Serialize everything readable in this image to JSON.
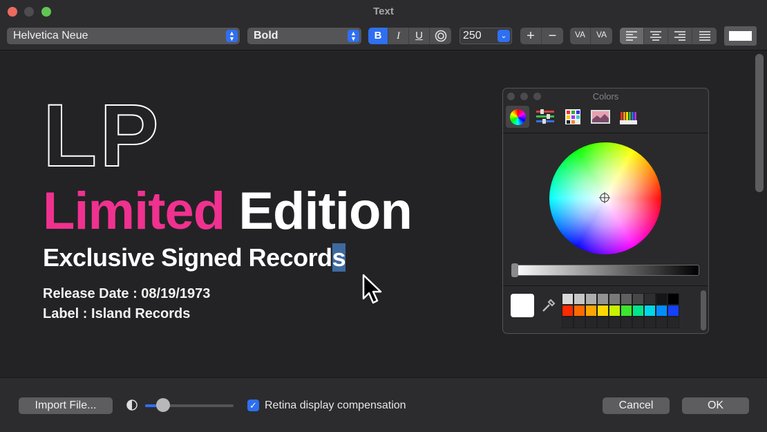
{
  "window": {
    "title": "Text"
  },
  "toolbar": {
    "font_family": "Helvetica Neue",
    "font_style": "Bold",
    "bold_label": "B",
    "italic_label": "I",
    "underline_label": "U",
    "font_size": "250",
    "increase_label": "+",
    "decrease_label": "−",
    "kern_tighten_label": "VA",
    "kern_loosen_label": "VA",
    "text_color": "#ffffff"
  },
  "canvas": {
    "line1": "LP",
    "line2_pink": "Limited",
    "line2_white": "Edition",
    "line3_main": "Exclusive Signed Record",
    "line3_selected": "s",
    "line4": "Release Date : 08/19/1973",
    "line5": "Label : Island Records",
    "pink_color": "#f0318f"
  },
  "colors_panel": {
    "title": "Colors",
    "modes": [
      "color-wheel",
      "color-sliders",
      "color-palettes",
      "image-palettes",
      "pencils"
    ],
    "selected_color": "#ffffff",
    "swatches": [
      [
        "#d9d9d9",
        "#c6c6c6",
        "#adadad",
        "#939393",
        "#7a7a7a",
        "#606060",
        "#474747",
        "#2e2e2e",
        "#151515",
        "#000000"
      ],
      [
        "#ff2a00",
        "#ff6a00",
        "#ffa500",
        "#ffd800",
        "#c8f000",
        "#3ce62e",
        "#00e68a",
        "#00d7e6",
        "#008cff",
        "#1440ff"
      ],
      [
        "#262628",
        "#262628",
        "#262628",
        "#262628",
        "#262628",
        "#262628",
        "#262628",
        "#262628",
        "#262628",
        "#262628"
      ]
    ]
  },
  "footer": {
    "import_button": "Import File...",
    "brightness_slider_value": 0.2,
    "retina_checkbox_label": "Retina display compensation",
    "retina_checked": true,
    "cancel_button": "Cancel",
    "ok_button": "OK"
  }
}
